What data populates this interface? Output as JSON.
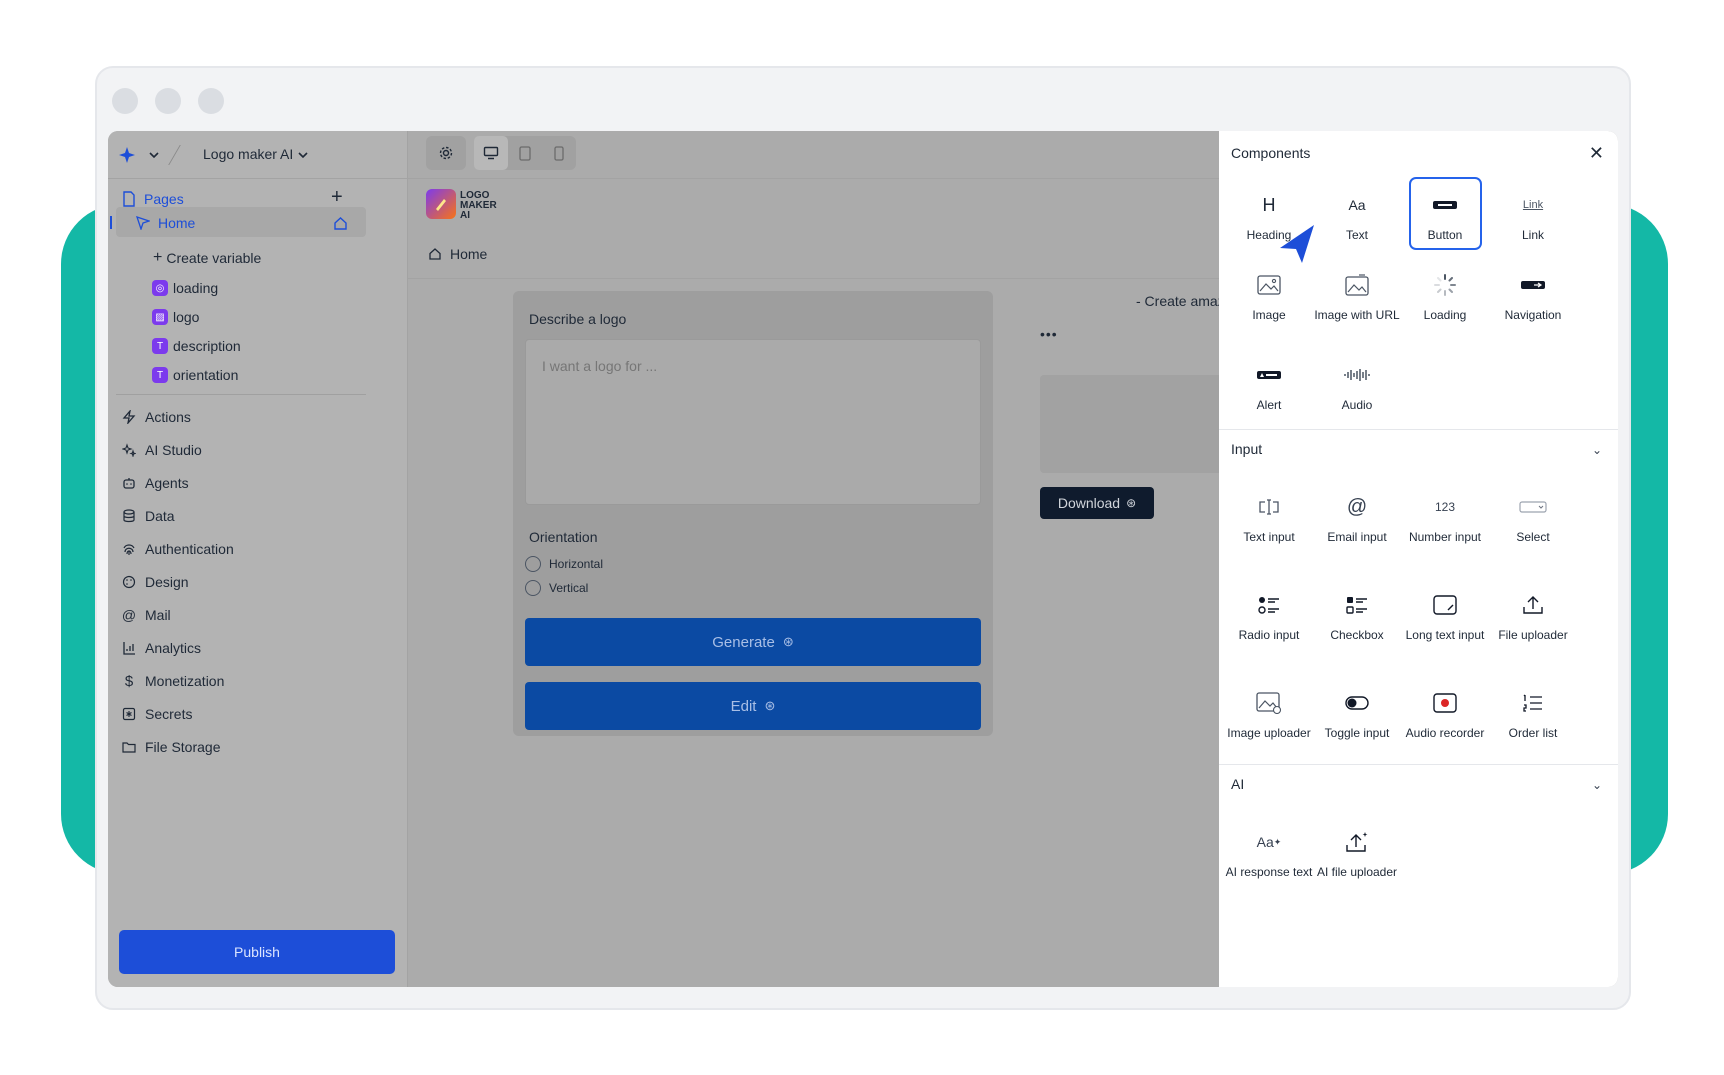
{
  "app": {
    "project_name": "Logo maker AI"
  },
  "sidebar": {
    "pages_label": "Pages",
    "home_label": "Home",
    "create_variable": "Create variable",
    "variables": [
      {
        "name": "loading",
        "badge": "◎"
      },
      {
        "name": "logo",
        "badge": "▨"
      },
      {
        "name": "description",
        "badge": "T"
      },
      {
        "name": "orientation",
        "badge": "T"
      }
    ],
    "nav": [
      "Actions",
      "AI Studio",
      "Agents",
      "Data",
      "Authentication",
      "Design",
      "Mail",
      "Analytics",
      "Monetization",
      "Secrets",
      "File Storage"
    ],
    "publish": "Publish"
  },
  "canvas": {
    "logo_text": "LOGO MAKER AI",
    "breadcrumb": "Home",
    "tagline": "- Create amaz",
    "card": {
      "title": "Describe a logo",
      "placeholder": "I want a logo for ...",
      "orientation_label": "Orientation",
      "options": [
        "Horizontal",
        "Vertical"
      ],
      "generate": "Generate",
      "edit": "Edit"
    },
    "more_dots": "•••",
    "download": "Download"
  },
  "panel": {
    "title": "Components",
    "basic": [
      {
        "label": "Heading",
        "icon": "H"
      },
      {
        "label": "Text",
        "icon": "Aa"
      },
      {
        "label": "Button",
        "icon": "▬"
      },
      {
        "label": "Link",
        "icon": "Link"
      },
      {
        "label": "Image",
        "icon": "🖾"
      },
      {
        "label": "Image with URL",
        "icon": "🖾"
      },
      {
        "label": "Loading",
        "icon": "◌"
      },
      {
        "label": "Navigation",
        "icon": "▬"
      },
      {
        "label": "Alert",
        "icon": "▬"
      },
      {
        "label": "Audio",
        "icon": "ıIıIı"
      }
    ],
    "input_label": "Input",
    "input": [
      {
        "label": "Text input",
        "icon": "⌶"
      },
      {
        "label": "Email input",
        "icon": "@"
      },
      {
        "label": "Number input",
        "icon": "123"
      },
      {
        "label": "Select",
        "icon": "▭"
      },
      {
        "label": "Radio input",
        "icon": "☰"
      },
      {
        "label": "Checkbox",
        "icon": "☑"
      },
      {
        "label": "Long text input",
        "icon": "▢"
      },
      {
        "label": "File uploader",
        "icon": "⇪"
      },
      {
        "label": "Image uploader",
        "icon": "🖾"
      },
      {
        "label": "Toggle input",
        "icon": "◐"
      },
      {
        "label": "Audio recorder",
        "icon": "◉"
      },
      {
        "label": "Order list",
        "icon": "☰"
      }
    ],
    "ai_label": "AI",
    "ai": [
      {
        "label": "AI response text",
        "icon": "Aa"
      },
      {
        "label": "AI file uploader",
        "icon": "⇪"
      }
    ]
  }
}
